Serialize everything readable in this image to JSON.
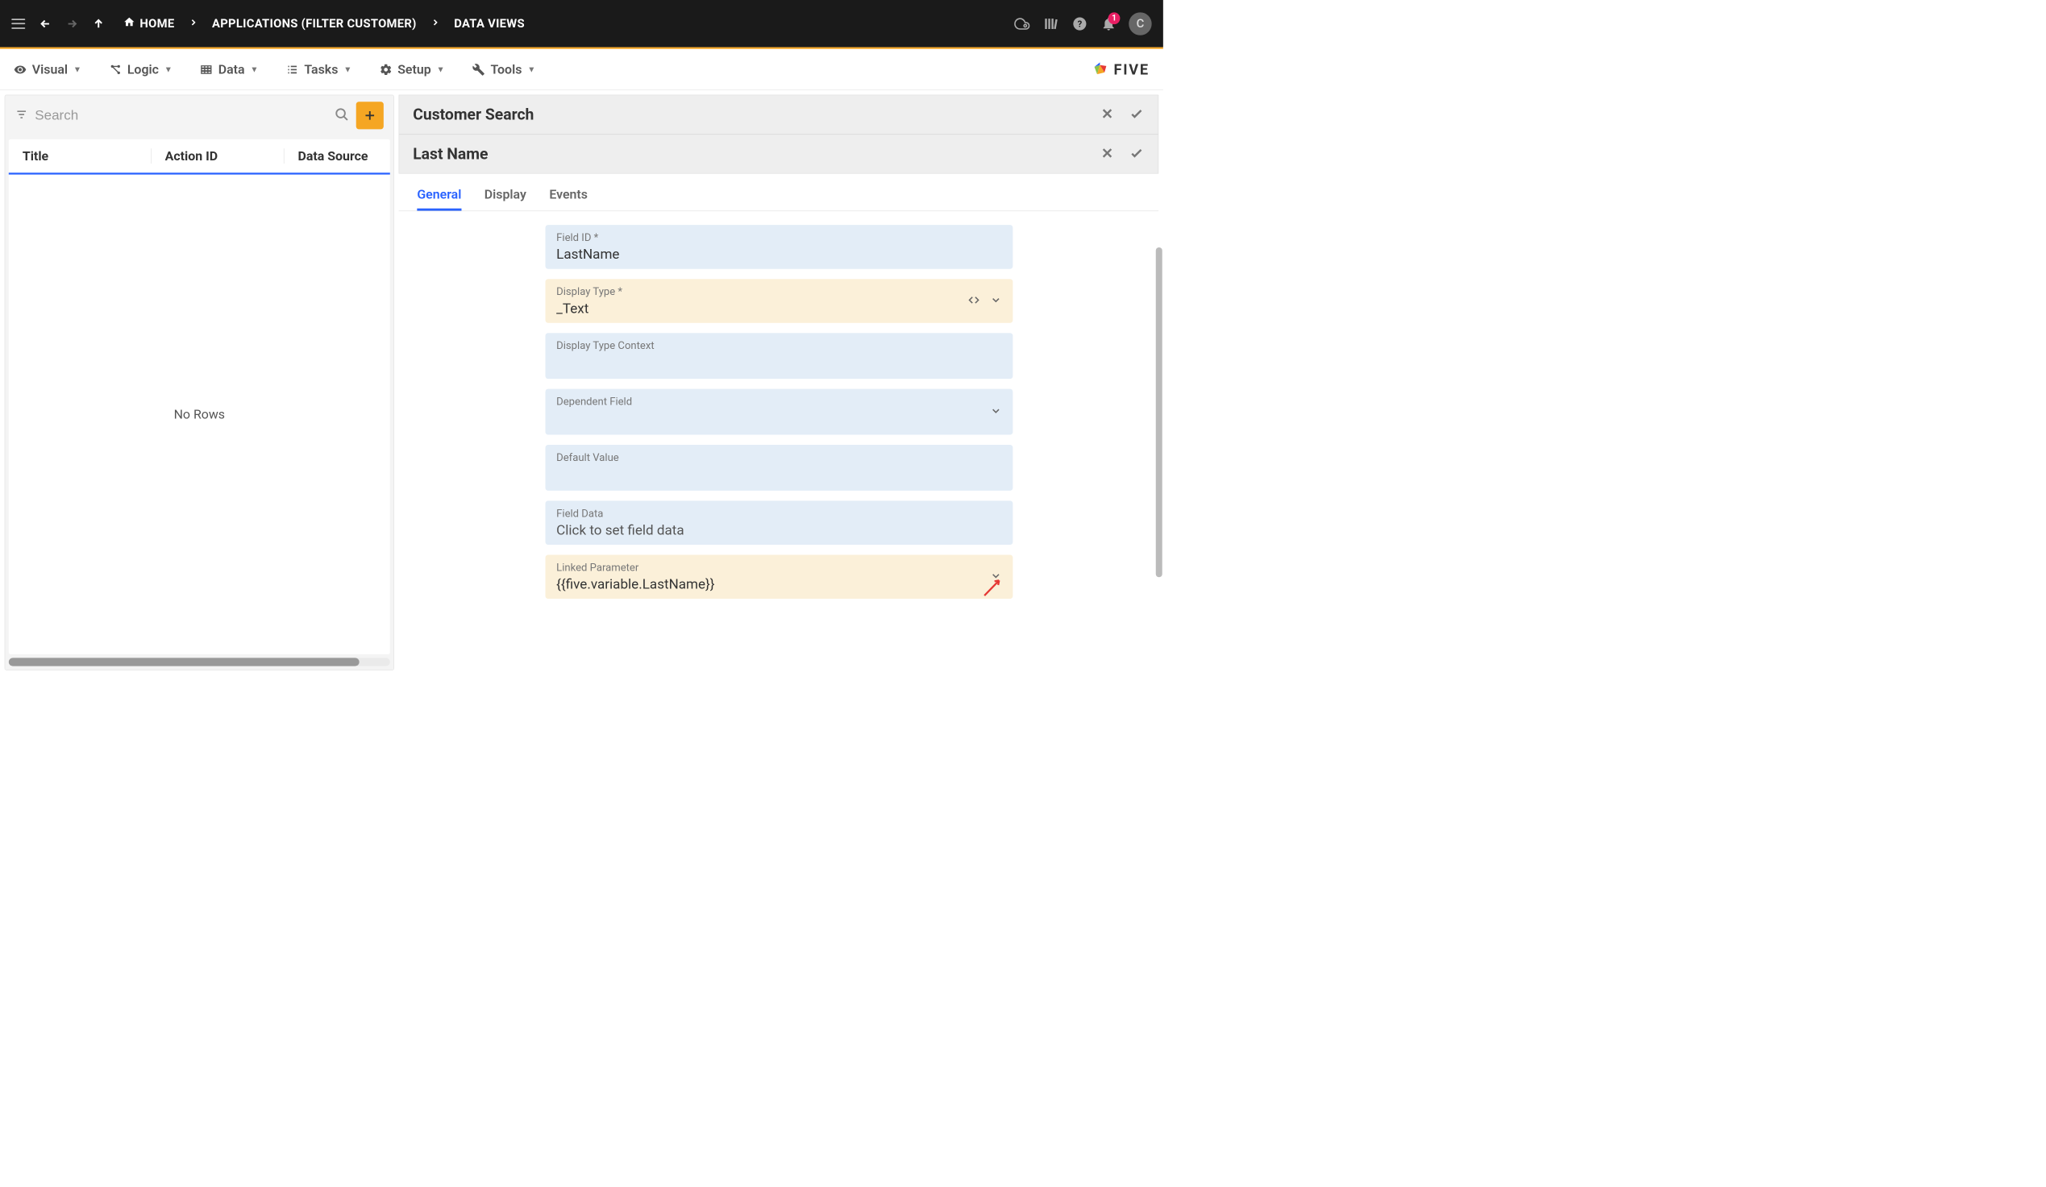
{
  "topbar": {
    "breadcrumb": [
      {
        "label": "HOME",
        "has_home_icon": true
      },
      {
        "label": "APPLICATIONS (FILTER CUSTOMER)"
      },
      {
        "label": "DATA VIEWS"
      }
    ],
    "notification_count": "1",
    "avatar_initial": "C"
  },
  "menubar": {
    "items": [
      {
        "label": "Visual"
      },
      {
        "label": "Logic"
      },
      {
        "label": "Data"
      },
      {
        "label": "Tasks"
      },
      {
        "label": "Setup"
      },
      {
        "label": "Tools"
      }
    ],
    "brand": "FIVE"
  },
  "left_panel": {
    "search_placeholder": "Search",
    "columns": [
      "Title",
      "Action ID",
      "Data Source"
    ],
    "empty_text": "No Rows"
  },
  "right_panel": {
    "section1_title": "Customer Search",
    "section2_title": "Last Name",
    "tabs": [
      "General",
      "Display",
      "Events"
    ],
    "active_tab": 0,
    "fields": {
      "field_id": {
        "label": "Field ID *",
        "value": "LastName"
      },
      "display_type": {
        "label": "Display Type *",
        "value": "_Text"
      },
      "display_type_context": {
        "label": "Display Type Context",
        "value": ""
      },
      "dependent_field": {
        "label": "Dependent Field",
        "value": ""
      },
      "default_value": {
        "label": "Default Value",
        "value": ""
      },
      "field_data": {
        "label": "Field Data",
        "value": "Click to set field data"
      },
      "linked_parameter": {
        "label": "Linked Parameter",
        "value": "{{five.variable.LastName}}"
      }
    }
  }
}
